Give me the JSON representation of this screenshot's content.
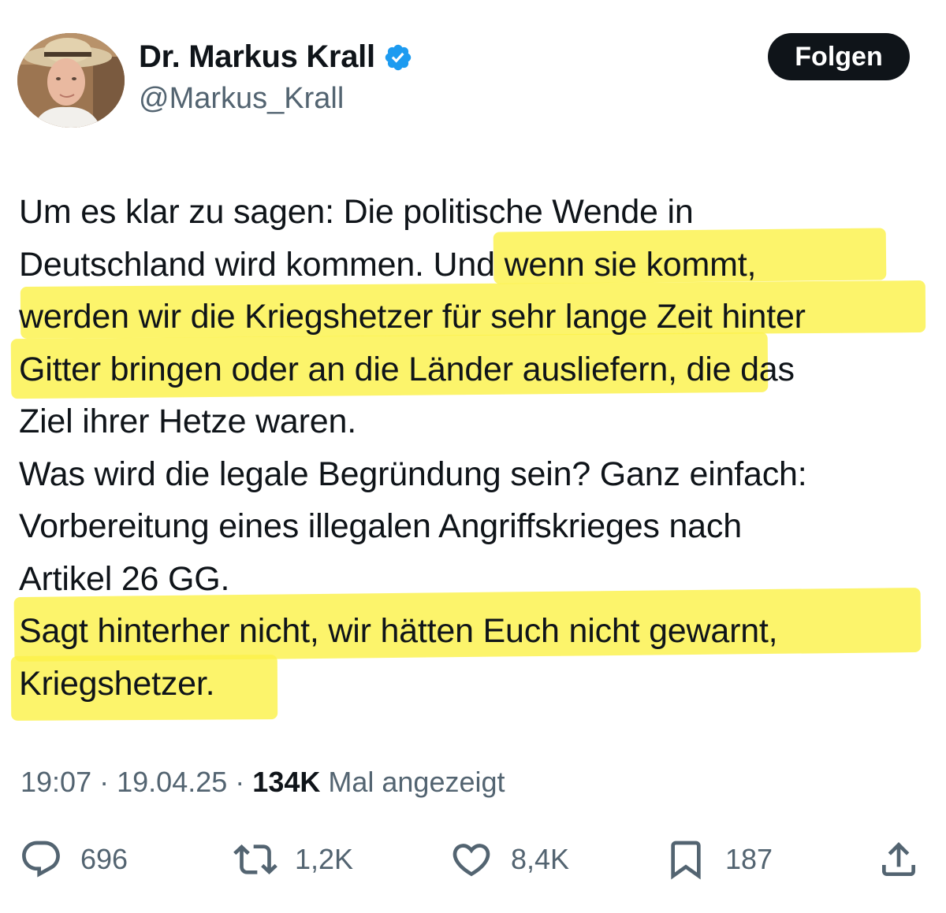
{
  "author": {
    "display_name": "Dr. Markus Krall",
    "handle": "@Markus_Krall",
    "verified_icon": "verified-badge-icon",
    "verified_color": "#1d9bf0"
  },
  "follow_label": "Folgen",
  "tweet": {
    "lines": [
      "Um es klar zu sagen: Die politische Wende in",
      "Deutschland wird kommen. Und wenn sie kommt,",
      "werden wir die Kriegshetzer für sehr lange Zeit hinter",
      "Gitter bringen oder an die Länder ausliefern, die das",
      "Ziel ihrer Hetze waren.",
      "Was wird die legale Begründung sein? Ganz einfach:",
      "Vorbereitung eines illegalen Angriffskrieges nach",
      "Artikel 26 GG.",
      "Sagt hinterher nicht, wir hätten Euch nicht gewarnt,",
      "Kriegshetzer."
    ],
    "highlighted_passages": [
      "Und wenn sie kommt, werden wir die Kriegshetzer für sehr lange Zeit hinter Gitter bringen oder an die Länder ausliefern",
      "Sagt hinterher nicht, wir hätten Euch nicht gewarnt, Kriegshetzer."
    ],
    "highlight_color": "#fbf24a"
  },
  "meta": {
    "time": "19:07",
    "date": "19.04.25",
    "separator": "·",
    "views_count": "134K",
    "views_label": "Mal angezeigt"
  },
  "actions": {
    "replies": {
      "icon": "reply-icon",
      "count": "696"
    },
    "reposts": {
      "icon": "repost-icon",
      "count": "1,2K"
    },
    "likes": {
      "icon": "like-icon",
      "count": "8,4K"
    },
    "bookmarks": {
      "icon": "bookmark-icon",
      "count": "187"
    },
    "share": {
      "icon": "share-icon"
    }
  },
  "colors": {
    "text_primary": "#0f1419",
    "text_secondary": "#536471",
    "button_bg": "#0f1419",
    "button_text": "#ffffff"
  }
}
